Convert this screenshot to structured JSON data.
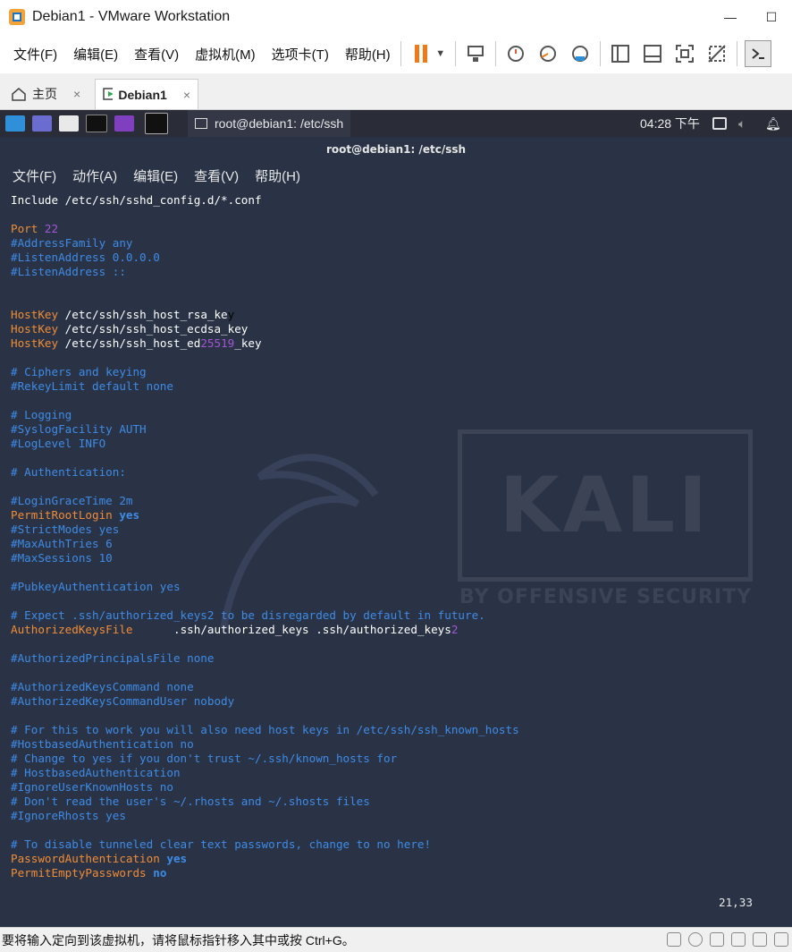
{
  "window": {
    "title": "Debian1 - VMware Workstation"
  },
  "menubar": {
    "items": [
      "文件(F)",
      "编辑(E)",
      "查看(V)",
      "虚拟机(M)",
      "选项卡(T)",
      "帮助(H)"
    ]
  },
  "tabs": [
    {
      "label": "主页",
      "close": "×"
    },
    {
      "label": "Debian1",
      "close": "×"
    }
  ],
  "guest_taskbar": {
    "window_label": "root@debian1: /etc/ssh",
    "clock": "04:28 下午"
  },
  "terminal": {
    "title": "root@debian1: /etc/ssh",
    "menu": [
      "文件(F)",
      "动作(A)",
      "编辑(E)",
      "查看(V)",
      "帮助(H)"
    ],
    "cursor_pos": "21,33",
    "lines": [
      [
        [
          "text",
          "Include /etc/ssh/sshd_config.d/*.conf"
        ]
      ],
      [],
      [
        [
          "key",
          "Port "
        ],
        [
          "num",
          "22"
        ]
      ],
      [
        [
          "comment",
          "#AddressFamily any"
        ]
      ],
      [
        [
          "comment",
          "#ListenAddress 0.0.0.0"
        ]
      ],
      [
        [
          "comment",
          "#ListenAddress ::"
        ]
      ],
      [],
      [],
      [
        [
          "key",
          "HostKey "
        ],
        [
          "text",
          "/etc/ssh/ssh_host_rsa_ke"
        ],
        [
          "cursor",
          "y"
        ]
      ],
      [
        [
          "key",
          "HostKey "
        ],
        [
          "text",
          "/etc/ssh/ssh_host_ecdsa_key"
        ]
      ],
      [
        [
          "key",
          "HostKey "
        ],
        [
          "text",
          "/etc/ssh/ssh_host_ed"
        ],
        [
          "num",
          "25519"
        ],
        [
          "text",
          "_key"
        ]
      ],
      [],
      [
        [
          "comment",
          "# Ciphers and keying"
        ]
      ],
      [
        [
          "comment",
          "#RekeyLimit default none"
        ]
      ],
      [],
      [
        [
          "comment",
          "# Logging"
        ]
      ],
      [
        [
          "comment",
          "#SyslogFacility AUTH"
        ]
      ],
      [
        [
          "comment",
          "#LogLevel INFO"
        ]
      ],
      [],
      [
        [
          "comment",
          "# Authentication:"
        ]
      ],
      [],
      [
        [
          "comment",
          "#LoginGraceTime 2m"
        ]
      ],
      [
        [
          "key",
          "PermitRootLogin "
        ],
        [
          "bool",
          "yes"
        ]
      ],
      [
        [
          "comment",
          "#StrictModes yes"
        ]
      ],
      [
        [
          "comment",
          "#MaxAuthTries 6"
        ]
      ],
      [
        [
          "comment",
          "#MaxSessions 10"
        ]
      ],
      [],
      [
        [
          "comment",
          "#PubkeyAuthentication yes"
        ]
      ],
      [],
      [
        [
          "comment",
          "# Expect .ssh/authorized_keys2 to be disregarded by default in future."
        ]
      ],
      [
        [
          "key",
          "AuthorizedKeysFile      "
        ],
        [
          "text",
          ".ssh/authorized_keys .ssh/authorized_keys"
        ],
        [
          "num",
          "2"
        ]
      ],
      [],
      [
        [
          "comment",
          "#AuthorizedPrincipalsFile none"
        ]
      ],
      [],
      [
        [
          "comment",
          "#AuthorizedKeysCommand none"
        ]
      ],
      [
        [
          "comment",
          "#AuthorizedKeysCommandUser nobody"
        ]
      ],
      [],
      [
        [
          "comment",
          "# For this to work you will also need host keys in /etc/ssh/ssh_known_hosts"
        ]
      ],
      [
        [
          "comment",
          "#HostbasedAuthentication no"
        ]
      ],
      [
        [
          "comment",
          "# Change to yes if you don't trust ~/.ssh/known_hosts for"
        ]
      ],
      [
        [
          "comment",
          "# HostbasedAuthentication"
        ]
      ],
      [
        [
          "comment",
          "#IgnoreUserKnownHosts no"
        ]
      ],
      [
        [
          "comment",
          "# Don't read the user's ~/.rhosts and ~/.shosts files"
        ]
      ],
      [
        [
          "comment",
          "#IgnoreRhosts yes"
        ]
      ],
      [],
      [
        [
          "comment",
          "# To disable tunneled clear text passwords, change to no here!"
        ]
      ],
      [
        [
          "key",
          "PasswordAuthentication "
        ],
        [
          "bool",
          "yes"
        ]
      ],
      [
        [
          "key",
          "PermitEmptyPasswords "
        ],
        [
          "bool",
          "no"
        ]
      ]
    ]
  },
  "wallpaper": {
    "logo": "KALI",
    "tagline": "BY OFFENSIVE SECURITY"
  },
  "statusbar": {
    "message": "要将输入定向到该虚拟机，请将鼠标指针移入其中或按 Ctrl+G。"
  }
}
